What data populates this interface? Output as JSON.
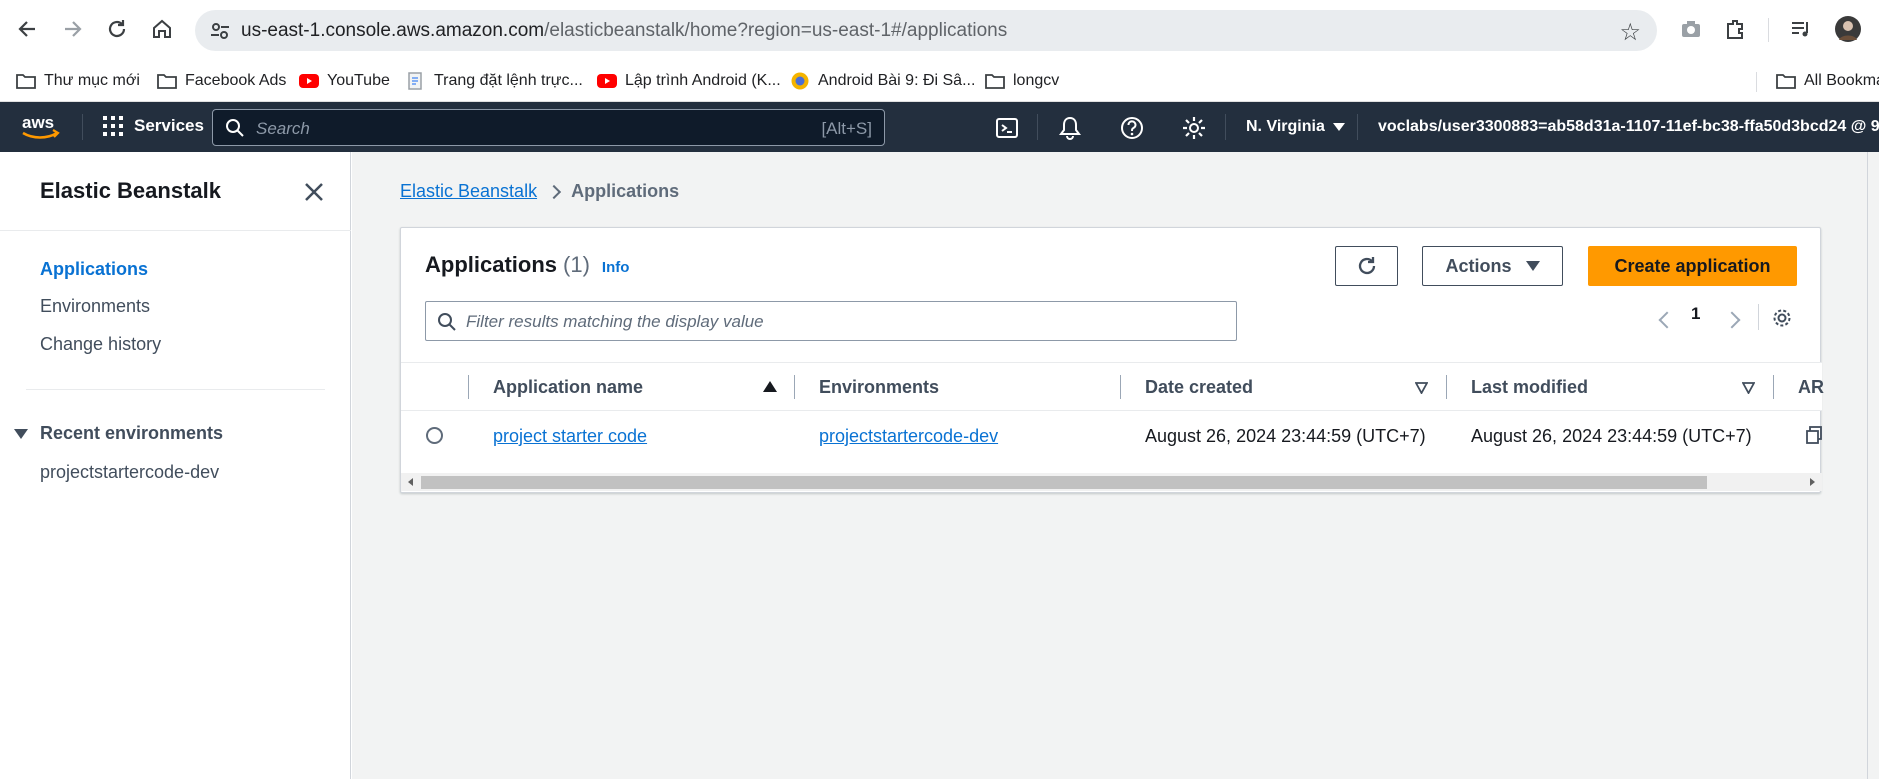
{
  "browser": {
    "url_host": "us-east-1.console.aws.amazon.com",
    "url_path": "/elasticbeanstalk/home?region=us-east-1#/applications",
    "bookmarks": [
      {
        "label": "Thư mục mới",
        "icon": "folder-icon"
      },
      {
        "label": "Facebook Ads",
        "icon": "folder-icon"
      },
      {
        "label": "YouTube",
        "icon": "youtube-icon"
      },
      {
        "label": "Trang đặt lệnh trực...",
        "icon": "page-icon"
      },
      {
        "label": "Lập trình Android (K...",
        "icon": "youtube-icon"
      },
      {
        "label": "Android Bài 9: Đi Sâ...",
        "icon": "site-icon"
      },
      {
        "label": "longcv",
        "icon": "folder-icon"
      }
    ],
    "all_bookmarks": "All Bookma"
  },
  "aws_nav": {
    "logo": "aws",
    "services_label": "Services",
    "search_placeholder": "Search",
    "search_shortcut": "[Alt+S]",
    "region": "N. Virginia",
    "account": "voclabs/user3300883=ab58d31a-1107-11ef-bc38-ffa50d3bcd24 @ 96..."
  },
  "sidebar": {
    "title": "Elastic Beanstalk",
    "items": [
      {
        "label": "Applications",
        "active": true
      },
      {
        "label": "Environments",
        "active": false
      },
      {
        "label": "Change history",
        "active": false
      }
    ],
    "recent_section": "Recent environments",
    "recent_items": [
      "projectstartercode-dev"
    ]
  },
  "breadcrumb": {
    "root": "Elastic Beanstalk",
    "current": "Applications"
  },
  "panel": {
    "title": "Applications",
    "count": "(1)",
    "info": "Info",
    "actions_label": "Actions",
    "create_label": "Create application",
    "filter_placeholder": "Filter results matching the display value",
    "page": "1"
  },
  "table": {
    "columns": [
      "Application name",
      "Environments",
      "Date created",
      "Last modified",
      "AR"
    ],
    "rows": [
      {
        "name": "project starter code",
        "environments": "projectstartercode-dev",
        "date_created": "August 26, 2024 23:44:59 (UTC+7)",
        "last_modified": "August 26, 2024 23:44:59 (UTC+7)"
      }
    ]
  },
  "colors": {
    "aws_nav_bg": "#232f3e",
    "link": "#0972d3",
    "primary_button": "#ff9900"
  }
}
